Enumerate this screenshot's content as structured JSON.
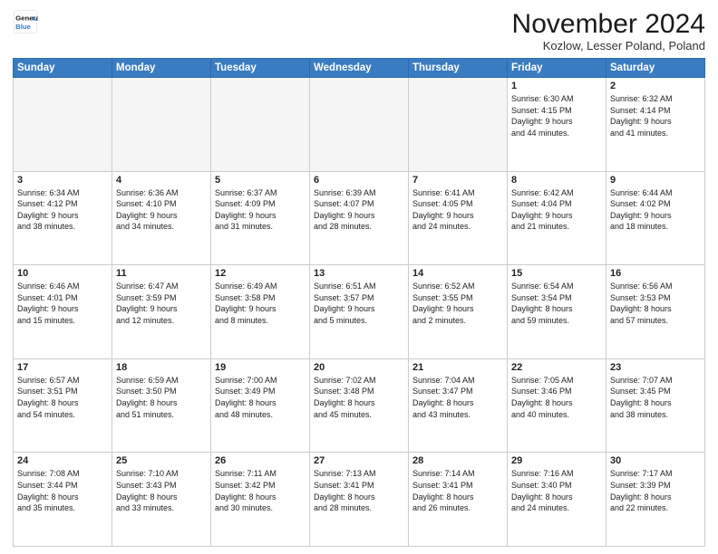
{
  "logo": {
    "line1": "General",
    "line2": "Blue"
  },
  "title": "November 2024",
  "subtitle": "Kozlow, Lesser Poland, Poland",
  "header_days": [
    "Sunday",
    "Monday",
    "Tuesday",
    "Wednesday",
    "Thursday",
    "Friday",
    "Saturday"
  ],
  "weeks": [
    [
      {
        "day": "",
        "info": ""
      },
      {
        "day": "",
        "info": ""
      },
      {
        "day": "",
        "info": ""
      },
      {
        "day": "",
        "info": ""
      },
      {
        "day": "",
        "info": ""
      },
      {
        "day": "1",
        "info": "Sunrise: 6:30 AM\nSunset: 4:15 PM\nDaylight: 9 hours\nand 44 minutes."
      },
      {
        "day": "2",
        "info": "Sunrise: 6:32 AM\nSunset: 4:14 PM\nDaylight: 9 hours\nand 41 minutes."
      }
    ],
    [
      {
        "day": "3",
        "info": "Sunrise: 6:34 AM\nSunset: 4:12 PM\nDaylight: 9 hours\nand 38 minutes."
      },
      {
        "day": "4",
        "info": "Sunrise: 6:36 AM\nSunset: 4:10 PM\nDaylight: 9 hours\nand 34 minutes."
      },
      {
        "day": "5",
        "info": "Sunrise: 6:37 AM\nSunset: 4:09 PM\nDaylight: 9 hours\nand 31 minutes."
      },
      {
        "day": "6",
        "info": "Sunrise: 6:39 AM\nSunset: 4:07 PM\nDaylight: 9 hours\nand 28 minutes."
      },
      {
        "day": "7",
        "info": "Sunrise: 6:41 AM\nSunset: 4:05 PM\nDaylight: 9 hours\nand 24 minutes."
      },
      {
        "day": "8",
        "info": "Sunrise: 6:42 AM\nSunset: 4:04 PM\nDaylight: 9 hours\nand 21 minutes."
      },
      {
        "day": "9",
        "info": "Sunrise: 6:44 AM\nSunset: 4:02 PM\nDaylight: 9 hours\nand 18 minutes."
      }
    ],
    [
      {
        "day": "10",
        "info": "Sunrise: 6:46 AM\nSunset: 4:01 PM\nDaylight: 9 hours\nand 15 minutes."
      },
      {
        "day": "11",
        "info": "Sunrise: 6:47 AM\nSunset: 3:59 PM\nDaylight: 9 hours\nand 12 minutes."
      },
      {
        "day": "12",
        "info": "Sunrise: 6:49 AM\nSunset: 3:58 PM\nDaylight: 9 hours\nand 8 minutes."
      },
      {
        "day": "13",
        "info": "Sunrise: 6:51 AM\nSunset: 3:57 PM\nDaylight: 9 hours\nand 5 minutes."
      },
      {
        "day": "14",
        "info": "Sunrise: 6:52 AM\nSunset: 3:55 PM\nDaylight: 9 hours\nand 2 minutes."
      },
      {
        "day": "15",
        "info": "Sunrise: 6:54 AM\nSunset: 3:54 PM\nDaylight: 8 hours\nand 59 minutes."
      },
      {
        "day": "16",
        "info": "Sunrise: 6:56 AM\nSunset: 3:53 PM\nDaylight: 8 hours\nand 57 minutes."
      }
    ],
    [
      {
        "day": "17",
        "info": "Sunrise: 6:57 AM\nSunset: 3:51 PM\nDaylight: 8 hours\nand 54 minutes."
      },
      {
        "day": "18",
        "info": "Sunrise: 6:59 AM\nSunset: 3:50 PM\nDaylight: 8 hours\nand 51 minutes."
      },
      {
        "day": "19",
        "info": "Sunrise: 7:00 AM\nSunset: 3:49 PM\nDaylight: 8 hours\nand 48 minutes."
      },
      {
        "day": "20",
        "info": "Sunrise: 7:02 AM\nSunset: 3:48 PM\nDaylight: 8 hours\nand 45 minutes."
      },
      {
        "day": "21",
        "info": "Sunrise: 7:04 AM\nSunset: 3:47 PM\nDaylight: 8 hours\nand 43 minutes."
      },
      {
        "day": "22",
        "info": "Sunrise: 7:05 AM\nSunset: 3:46 PM\nDaylight: 8 hours\nand 40 minutes."
      },
      {
        "day": "23",
        "info": "Sunrise: 7:07 AM\nSunset: 3:45 PM\nDaylight: 8 hours\nand 38 minutes."
      }
    ],
    [
      {
        "day": "24",
        "info": "Sunrise: 7:08 AM\nSunset: 3:44 PM\nDaylight: 8 hours\nand 35 minutes."
      },
      {
        "day": "25",
        "info": "Sunrise: 7:10 AM\nSunset: 3:43 PM\nDaylight: 8 hours\nand 33 minutes."
      },
      {
        "day": "26",
        "info": "Sunrise: 7:11 AM\nSunset: 3:42 PM\nDaylight: 8 hours\nand 30 minutes."
      },
      {
        "day": "27",
        "info": "Sunrise: 7:13 AM\nSunset: 3:41 PM\nDaylight: 8 hours\nand 28 minutes."
      },
      {
        "day": "28",
        "info": "Sunrise: 7:14 AM\nSunset: 3:41 PM\nDaylight: 8 hours\nand 26 minutes."
      },
      {
        "day": "29",
        "info": "Sunrise: 7:16 AM\nSunset: 3:40 PM\nDaylight: 8 hours\nand 24 minutes."
      },
      {
        "day": "30",
        "info": "Sunrise: 7:17 AM\nSunset: 3:39 PM\nDaylight: 8 hours\nand 22 minutes."
      }
    ]
  ]
}
